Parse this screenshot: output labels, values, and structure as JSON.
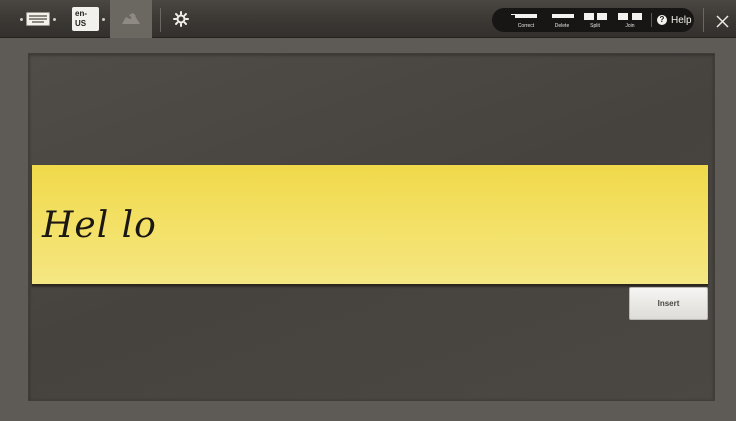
{
  "toolbar": {
    "keyboard_icon": "keyboard-icon",
    "language": "en-US",
    "erase_icon": "eraser-icon",
    "settings_icon": "gear-icon",
    "corrections": [
      {
        "label": "Correct",
        "icon": "correct-icon"
      },
      {
        "label": "Delete",
        "icon": "delete-icon"
      },
      {
        "label": "Split",
        "icon": "split-icon"
      },
      {
        "label": "Join",
        "icon": "join-icon"
      }
    ],
    "help_label": "Help",
    "help_icon": "help-icon",
    "close_icon": "close-icon"
  },
  "writing_pad": {
    "recognized_ink": "Hel lo"
  },
  "insert_button": "Insert",
  "colors": {
    "strip_yellow": "#f3e063",
    "toolbar_dark": "#3b3834",
    "pad_background": "#4b4743"
  }
}
